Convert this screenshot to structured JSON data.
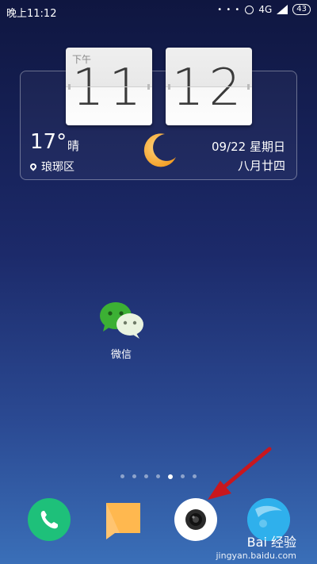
{
  "status_bar": {
    "time": "晚上11:12",
    "signal_dots": "• • •",
    "network": "4G",
    "battery": "43"
  },
  "clock_widget": {
    "ampm": "下午",
    "hour": "11",
    "minute": "12",
    "temperature": "17°",
    "condition": "晴",
    "location": "琅琊区",
    "date": "09/22  星期日",
    "lunar_date": "八月廿四"
  },
  "apps": {
    "wechat_label": "微信"
  },
  "pager": {
    "count": 7,
    "active_index": 4
  },
  "dock": {
    "phone": "phone-icon",
    "messages": "messages-icon",
    "camera": "camera-icon",
    "browser": "browser-icon"
  },
  "watermark": {
    "brand": "Bai  经验",
    "url": "jingyan.baidu.com"
  },
  "colors": {
    "phone": "#1ec07a",
    "camera": "#ffffff",
    "browser": "#2fb0ec",
    "arrow": "#c8171e"
  }
}
